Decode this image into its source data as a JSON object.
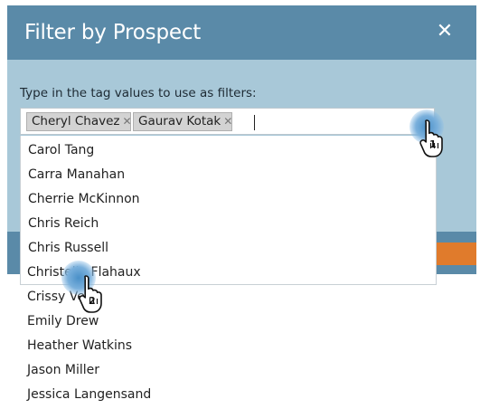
{
  "dialog": {
    "title": "Filter by Prospect",
    "close_icon": "close-icon",
    "instruction": "Type in the tag values to use as filters:"
  },
  "tags": [
    {
      "label": "Cheryl Chavez",
      "remove_icon": "✕"
    },
    {
      "label": "Gaurav Kotak",
      "remove_icon": "✕"
    }
  ],
  "dropdown": {
    "items": [
      "Carol Tang",
      "Carra Manahan",
      "Cherrie McKinnon",
      "Chris Reich",
      "Chris Russell",
      "Christelle Flahaux",
      "Crissy Vee",
      "Emily Drew",
      "Heather Watkins",
      "Jason Miller",
      "Jessica Langensand"
    ],
    "highlighted": "Christelle Flahaux"
  },
  "annotations": {
    "step1": "1",
    "step2": "2"
  },
  "colors": {
    "header": "#5a8aa8",
    "body": "#a8c8d8",
    "highlight": "#cfe5f5",
    "accent": "#e07b2c"
  }
}
